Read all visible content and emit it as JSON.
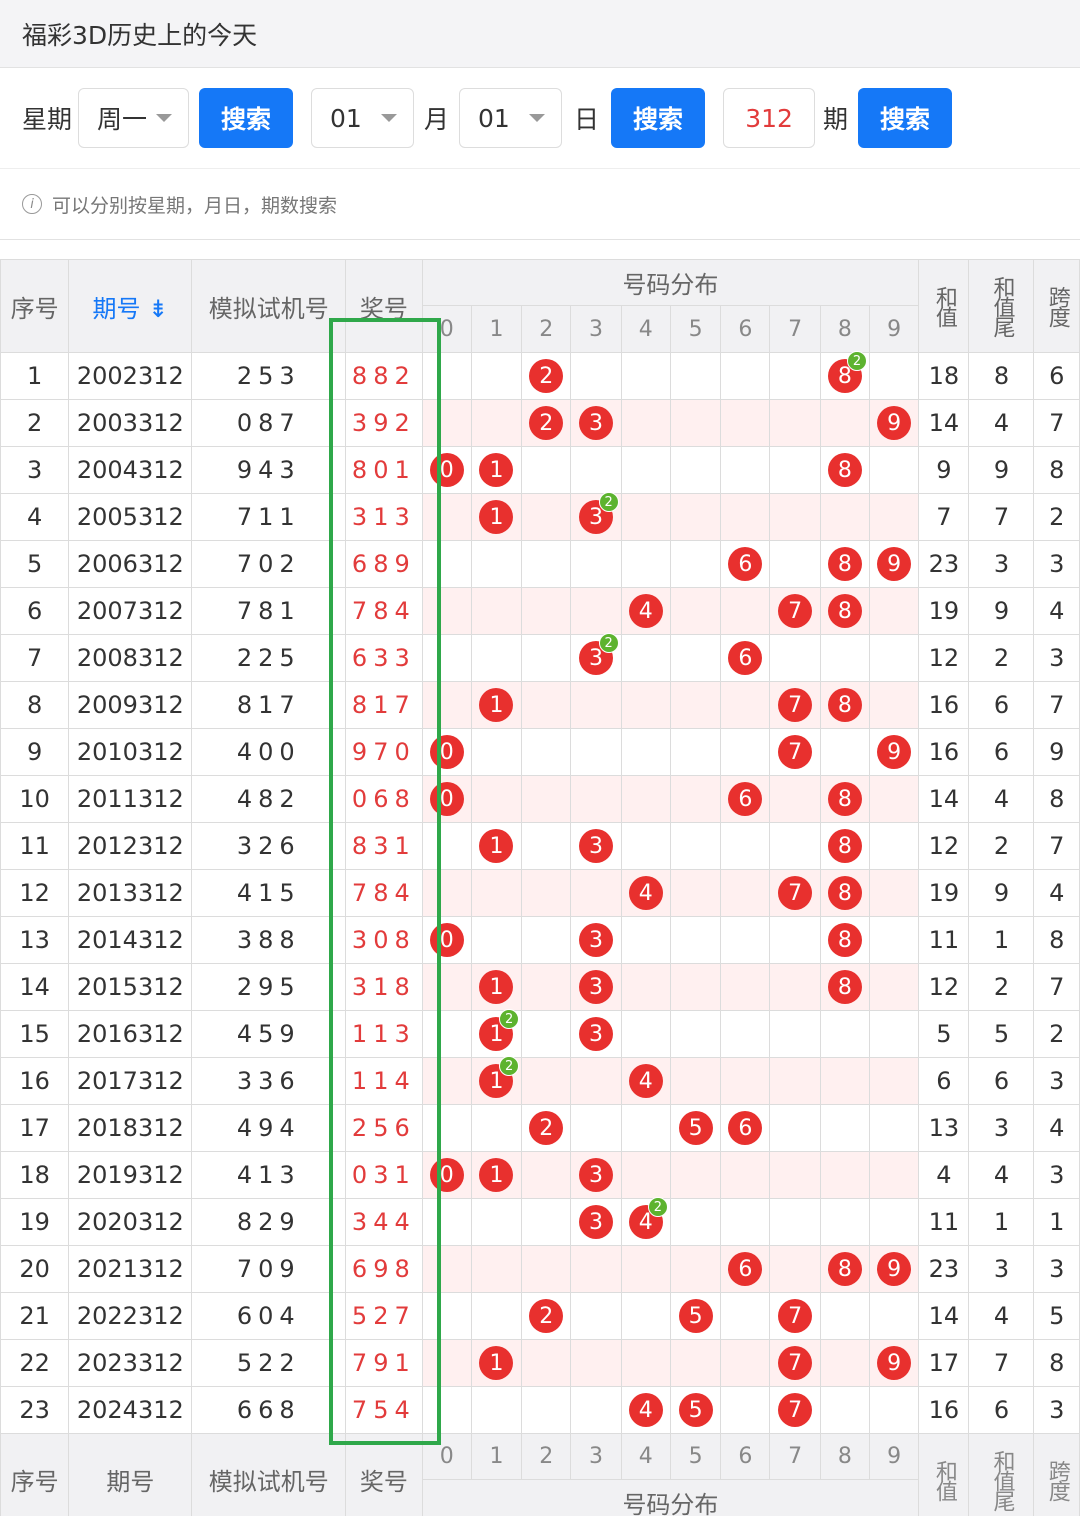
{
  "app_title": "福彩3D历史上的今天",
  "search": {
    "weekday_label": "星期",
    "weekday_value": "周一",
    "search_btn": "搜索",
    "month_value": "01",
    "month_label": "月",
    "day_value": "01",
    "day_label": "日",
    "period_value": "312",
    "period_label": "期",
    "tip": "可以分别按星期，月日，期数搜索"
  },
  "table": {
    "headers": {
      "seq": "序号",
      "period": "期号",
      "sim": "模拟试机号",
      "prize": "奖号",
      "dist": "号码分布",
      "sum": "和值",
      "sum_tail": "和值尾",
      "span": "跨度"
    },
    "digits": [
      "0",
      "1",
      "2",
      "3",
      "4",
      "5",
      "6",
      "7",
      "8",
      "9"
    ],
    "rows": [
      {
        "seq": "1",
        "period": "2002312",
        "sim": "253",
        "prize": "882",
        "sum": "18",
        "tail": "8",
        "span": "6"
      },
      {
        "seq": "2",
        "period": "2003312",
        "sim": "087",
        "prize": "392",
        "sum": "14",
        "tail": "4",
        "span": "7"
      },
      {
        "seq": "3",
        "period": "2004312",
        "sim": "943",
        "prize": "801",
        "sum": "9",
        "tail": "9",
        "span": "8"
      },
      {
        "seq": "4",
        "period": "2005312",
        "sim": "711",
        "prize": "313",
        "sum": "7",
        "tail": "7",
        "span": "2"
      },
      {
        "seq": "5",
        "period": "2006312",
        "sim": "702",
        "prize": "689",
        "sum": "23",
        "tail": "3",
        "span": "3"
      },
      {
        "seq": "6",
        "period": "2007312",
        "sim": "781",
        "prize": "784",
        "sum": "19",
        "tail": "9",
        "span": "4"
      },
      {
        "seq": "7",
        "period": "2008312",
        "sim": "225",
        "prize": "633",
        "sum": "12",
        "tail": "2",
        "span": "3"
      },
      {
        "seq": "8",
        "period": "2009312",
        "sim": "817",
        "prize": "817",
        "sum": "16",
        "tail": "6",
        "span": "7"
      },
      {
        "seq": "9",
        "period": "2010312",
        "sim": "400",
        "prize": "970",
        "sum": "16",
        "tail": "6",
        "span": "9"
      },
      {
        "seq": "10",
        "period": "2011312",
        "sim": "482",
        "prize": "068",
        "sum": "14",
        "tail": "4",
        "span": "8"
      },
      {
        "seq": "11",
        "period": "2012312",
        "sim": "326",
        "prize": "831",
        "sum": "12",
        "tail": "2",
        "span": "7"
      },
      {
        "seq": "12",
        "period": "2013312",
        "sim": "415",
        "prize": "784",
        "sum": "19",
        "tail": "9",
        "span": "4"
      },
      {
        "seq": "13",
        "period": "2014312",
        "sim": "388",
        "prize": "308",
        "sum": "11",
        "tail": "1",
        "span": "8"
      },
      {
        "seq": "14",
        "period": "2015312",
        "sim": "295",
        "prize": "318",
        "sum": "12",
        "tail": "2",
        "span": "7"
      },
      {
        "seq": "15",
        "period": "2016312",
        "sim": "459",
        "prize": "113",
        "sum": "5",
        "tail": "5",
        "span": "2"
      },
      {
        "seq": "16",
        "period": "2017312",
        "sim": "336",
        "prize": "114",
        "sum": "6",
        "tail": "6",
        "span": "3"
      },
      {
        "seq": "17",
        "period": "2018312",
        "sim": "494",
        "prize": "256",
        "sum": "13",
        "tail": "3",
        "span": "4"
      },
      {
        "seq": "18",
        "period": "2019312",
        "sim": "413",
        "prize": "031",
        "sum": "4",
        "tail": "4",
        "span": "3"
      },
      {
        "seq": "19",
        "period": "2020312",
        "sim": "829",
        "prize": "344",
        "sum": "11",
        "tail": "1",
        "span": "1"
      },
      {
        "seq": "20",
        "period": "2021312",
        "sim": "709",
        "prize": "698",
        "sum": "23",
        "tail": "3",
        "span": "3"
      },
      {
        "seq": "21",
        "period": "2022312",
        "sim": "604",
        "prize": "527",
        "sum": "14",
        "tail": "4",
        "span": "5"
      },
      {
        "seq": "22",
        "period": "2023312",
        "sim": "522",
        "prize": "791",
        "sum": "17",
        "tail": "7",
        "span": "8"
      },
      {
        "seq": "23",
        "period": "2024312",
        "sim": "668",
        "prize": "754",
        "sum": "16",
        "tail": "6",
        "span": "3"
      }
    ]
  }
}
